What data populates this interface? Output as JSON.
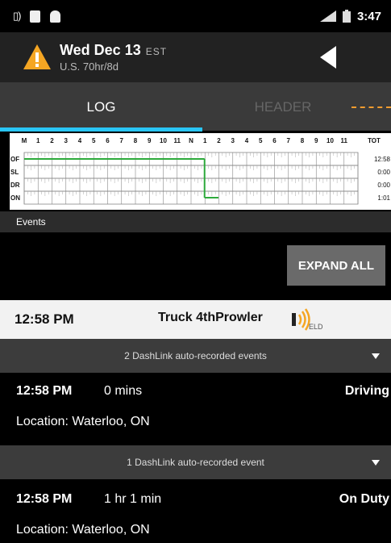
{
  "status_bar": {
    "time": "3:47"
  },
  "header": {
    "date": "Wed Dec 13",
    "timezone": "EST",
    "ruleset": "U.S. 70hr/8d",
    "warning_color": "#f5a623"
  },
  "tabs": [
    {
      "label": "LOG",
      "active": true
    },
    {
      "label": "HEADER",
      "active": false
    }
  ],
  "log_grid": {
    "hour_labels": [
      "M",
      "1",
      "2",
      "3",
      "4",
      "5",
      "6",
      "7",
      "8",
      "9",
      "10",
      "11",
      "N",
      "1",
      "2",
      "3",
      "4",
      "5",
      "6",
      "7",
      "8",
      "9",
      "10",
      "11"
    ],
    "total_label": "TOT",
    "rows": [
      {
        "label": "OF",
        "total": "12:58"
      },
      {
        "label": "SL",
        "total": "0:00"
      },
      {
        "label": "DR",
        "total": "0:00"
      },
      {
        "label": "ON",
        "total": "1:01"
      }
    ],
    "segments": [
      {
        "status": "OF",
        "start_hour": 0,
        "end_hour": 12.97
      },
      {
        "status": "ON",
        "start_hour": 12.97,
        "end_hour": 13.97
      }
    ],
    "line_color": "#2eaa3c"
  },
  "events": {
    "section_label": "Events",
    "expand_all_label": "EXPAND ALL",
    "truck": {
      "time": "12:58 PM",
      "name": "Truck 4thProwler",
      "badge": "ELD"
    },
    "groups": [
      {
        "summary": "2 DashLink auto-recorded events",
        "time": "12:58 PM",
        "duration": "0 mins",
        "status": "Driving",
        "location_label": "Location:",
        "location": "Waterloo, ON"
      },
      {
        "summary": "1 DashLink auto-recorded event",
        "time": "12:58 PM",
        "duration": "1 hr 1 min",
        "status": "On Duty",
        "location_label": "Location:",
        "location": "Waterloo, ON"
      }
    ]
  }
}
